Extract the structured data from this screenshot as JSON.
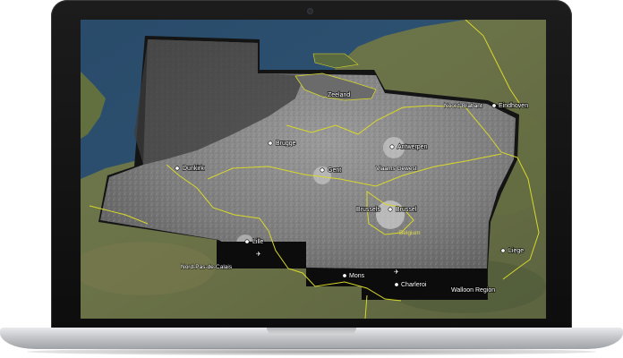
{
  "device": {
    "type": "laptop",
    "bezel_color": "#111111",
    "body_color": "#c8cacd"
  },
  "map": {
    "base_layer": "satellite imagery",
    "overlay": "grayscale radar mosaic over Belgium",
    "border_color": "#d8d82a",
    "cities": {
      "eindhoven": "Eindhoven",
      "antwerpen": "Antwerpen",
      "brugge": "Brugge",
      "gent": "Gent",
      "dunkirk": "Dunkirk",
      "brussels": "Brussels",
      "brussel": "Brussel",
      "lille": "Lille",
      "mons": "Mons",
      "charleroi": "Charleroi",
      "liege": "Liege"
    },
    "regions": {
      "zeeland": "Zeeland",
      "noord_brabant": "Noord-Brabant",
      "vlaams_gewest": "Vlaams Gewest",
      "belgium": "Belgium",
      "nord_pas_de_calais": "Nord-Pas-de-Calais",
      "walloon_region": "Walloon Region"
    },
    "icons": {
      "city_marker": "city-dot-icon",
      "airport": "airport-icon"
    }
  }
}
